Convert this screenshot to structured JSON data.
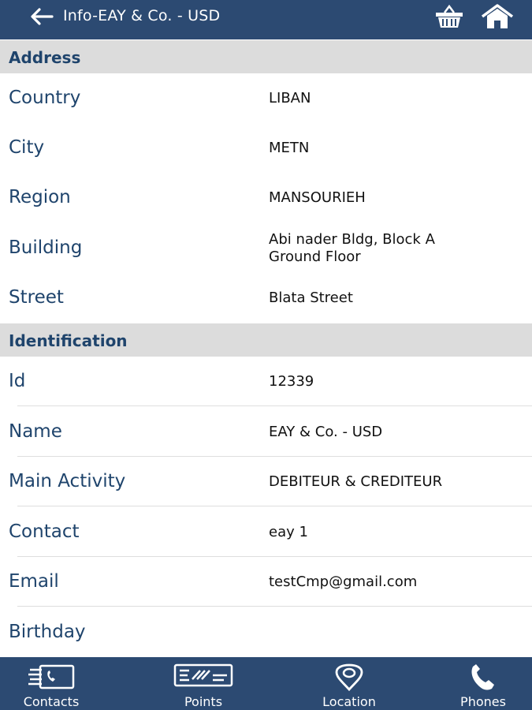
{
  "header": {
    "title": "Info-EAY & Co. - USD",
    "icons": [
      "back-arrow-icon",
      "basket-icon",
      "home-icon"
    ]
  },
  "sections": {
    "address": {
      "title": "Address",
      "rows": [
        {
          "label": "Country",
          "value": "LIBAN"
        },
        {
          "label": "City",
          "value": "METN"
        },
        {
          "label": "Region",
          "value": "MANSOURIEH"
        },
        {
          "label": "Building",
          "value_line1": "Abi nader Bldg, Block A",
          "value_line2": "Ground Floor"
        },
        {
          "label": "Street",
          "value": "Blata Street"
        }
      ]
    },
    "identification": {
      "title": "Identification",
      "rows": [
        {
          "label": "Id",
          "value": "12339"
        },
        {
          "label": "Name",
          "value": "EAY & Co. - USD"
        },
        {
          "label": "Main Activity",
          "value": "DEBITEUR & CREDITEUR"
        },
        {
          "label": "Contact",
          "value": "eay 1"
        },
        {
          "label": "Email",
          "value": "testCmp@gmail.com"
        },
        {
          "label": "Birthday",
          "value": ""
        }
      ]
    }
  },
  "tabs": [
    {
      "label": "Contacts",
      "icon": "contacts-icon"
    },
    {
      "label": "Points",
      "icon": "points-card-icon"
    },
    {
      "label": "Location",
      "icon": "location-pin-icon"
    },
    {
      "label": "Phones",
      "icon": "phone-icon"
    }
  ],
  "colors": {
    "bar": "#2c4a72",
    "label": "#1f446c",
    "section_bg": "#dcdcdc"
  }
}
